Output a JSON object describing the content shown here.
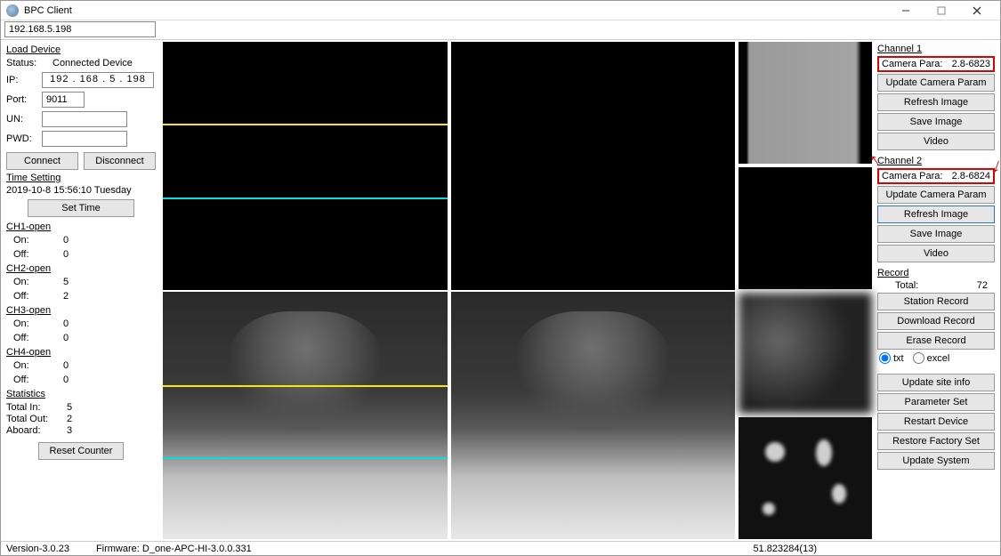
{
  "title": "BPC Client",
  "address": "192.168.5.198",
  "loadDevice": {
    "title": "Load Device",
    "statusLabel": "Status:",
    "statusValue": "Connected Device",
    "ipLabel": "IP:",
    "ipValue": "192 . 168 .   5  . 198",
    "portLabel": "Port:",
    "portValue": "9011",
    "unLabel": "UN:",
    "unValue": "",
    "pwdLabel": "PWD:",
    "pwdValue": "",
    "connect": "Connect",
    "disconnect": "Disconnect"
  },
  "timeSetting": {
    "title": "Time Setting",
    "datetime": "2019-10-8  15:56:10   Tuesday",
    "setTime": "Set Time"
  },
  "channels": [
    {
      "name": "CH1-open",
      "onLabel": "On:",
      "on": "0",
      "offLabel": "Off:",
      "off": "0"
    },
    {
      "name": "CH2-open",
      "onLabel": "On:",
      "on": "5",
      "offLabel": "Off:",
      "off": "2"
    },
    {
      "name": "CH3-open",
      "onLabel": "On:",
      "on": "0",
      "offLabel": "Off:",
      "off": "0"
    },
    {
      "name": "CH4-open",
      "onLabel": "On:",
      "on": "0",
      "offLabel": "Off:",
      "off": "0"
    }
  ],
  "stats": {
    "title": "Statistics",
    "totalInLabel": "Total In:",
    "totalIn": "5",
    "totalOutLabel": "Total Out:",
    "totalOut": "2",
    "aboardLabel": "Aboard:",
    "aboard": "3"
  },
  "resetCounter": "Reset Counter",
  "rightPanel": {
    "ch1": {
      "title": "Channel 1",
      "paraLabel": "Camera Para:",
      "paraValue": "2.8-6823",
      "update": "Update Camera Param",
      "refresh": "Refresh Image",
      "save": "Save Image",
      "video": "Video"
    },
    "ch2": {
      "title": "Channel 2",
      "paraLabel": "Camera Para:",
      "paraValue": "2.8-6824",
      "update": "Update Camera Param",
      "refresh": "Refresh Image",
      "save": "Save Image",
      "video": "Video"
    },
    "record": {
      "title": "Record",
      "totalLabel": "Total:",
      "totalValue": "72",
      "station": "Station Record",
      "download": "Download Record",
      "erase": "Erase Record",
      "txt": "txt",
      "excel": "excel"
    },
    "updateSite": "Update site info",
    "paramSet": "Parameter Set",
    "restart": "Restart Device",
    "restore": "Restore Factory Set",
    "updateSystem": "Update System"
  },
  "statusBar": {
    "version": "Version-3.0.23",
    "firmware": "Firmware: D_one-APC-HI-3.0.0.331",
    "coord": "51.823284(13)"
  }
}
